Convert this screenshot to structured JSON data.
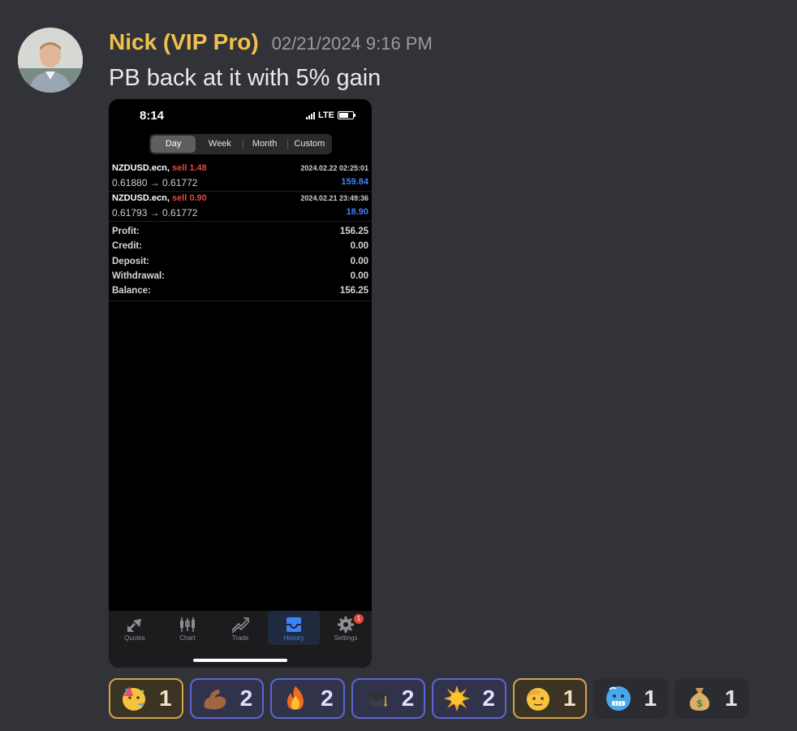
{
  "message": {
    "username": "Nick (VIP Pro)",
    "timestamp": "02/21/2024 9:16 PM",
    "text": "PB back at it with 5% gain"
  },
  "screenshot": {
    "status": {
      "time": "8:14",
      "network": "LTE"
    },
    "tabs": [
      "Day",
      "Week",
      "Month",
      "Custom"
    ],
    "active_tab": "Day",
    "trades": [
      {
        "symbol": "NZDUSD.ecn,",
        "action": "sell 1.48",
        "prices": "0.61880 → 0.61772",
        "date": "2024.02.22 02:25:01",
        "profit": "159.84"
      },
      {
        "symbol": "NZDUSD.ecn,",
        "action": "sell 0.90",
        "prices": "0.61793 → 0.61772",
        "date": "2024.02.21 23:49:36",
        "profit": "18.90"
      }
    ],
    "summary": [
      {
        "label": "Profit:",
        "value": "156.25"
      },
      {
        "label": "Credit:",
        "value": "0.00"
      },
      {
        "label": "Deposit:",
        "value": "0.00"
      },
      {
        "label": "Withdrawal:",
        "value": "0.00"
      },
      {
        "label": "Balance:",
        "value": "156.25"
      }
    ],
    "nav": [
      {
        "label": "Quotes",
        "icon": "quotes-icon"
      },
      {
        "label": "Chart",
        "icon": "candlestick-icon"
      },
      {
        "label": "Trade",
        "icon": "trade-icon"
      },
      {
        "label": "History",
        "icon": "inbox-icon"
      },
      {
        "label": "Settings",
        "icon": "gear-icon"
      }
    ],
    "settings_badge": "1"
  },
  "reactions": [
    {
      "emoji": "partying-face",
      "count": "1"
    },
    {
      "emoji": "flexed-biceps",
      "count": "2"
    },
    {
      "emoji": "fire",
      "count": "2"
    },
    {
      "emoji": "graduation-cap",
      "count": "2"
    },
    {
      "emoji": "sun",
      "count": "2"
    },
    {
      "emoji": "saluting-face",
      "count": "1"
    },
    {
      "emoji": "cold-face",
      "count": "1"
    },
    {
      "emoji": "money-bag",
      "count": "1"
    }
  ]
}
